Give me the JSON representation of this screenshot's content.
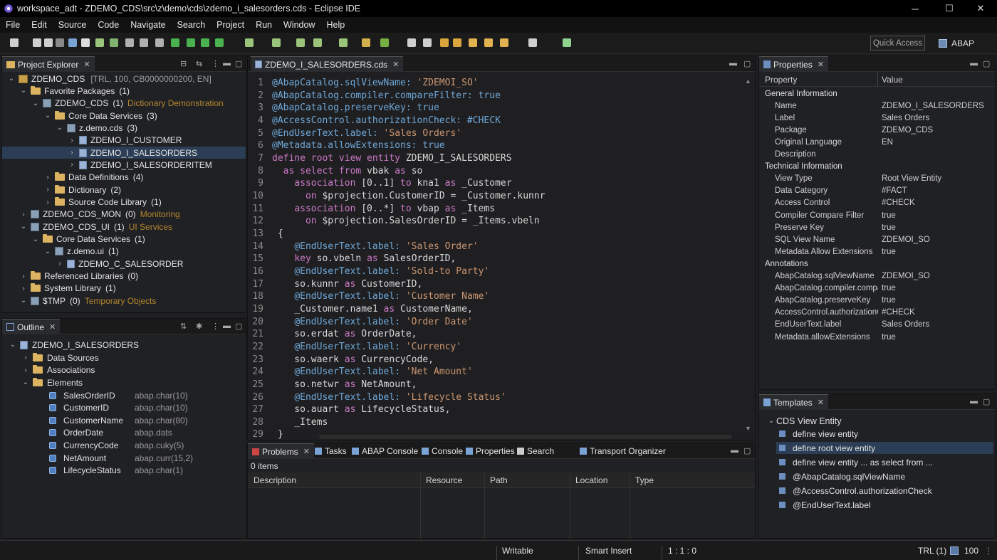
{
  "window": {
    "title": "workspace_adt - ZDEMO_CDS\\src\\z\\demo\\cds\\zdemo_i_salesorders.cds - Eclipse IDE",
    "minimize": "─",
    "maximize": "☐",
    "close": "✕"
  },
  "menu": [
    "File",
    "Edit",
    "Source",
    "Code",
    "Navigate",
    "Search",
    "Project",
    "Run",
    "Window",
    "Help"
  ],
  "toolbar": {
    "quick_access": "Quick Access",
    "perspective": "ABAP"
  },
  "project_explorer": {
    "title": "Project Explorer",
    "items": [
      {
        "label": "ZDEMO_CDS",
        "note": "[TRL, 100, CB0000000200, EN]",
        "note_style": "muted",
        "indent": 0,
        "twisty": "⌄",
        "icon": "project"
      },
      {
        "label": "Favorite Packages",
        "count": "(1)",
        "indent": 1,
        "twisty": "⌄",
        "icon": "folder"
      },
      {
        "label": "ZDEMO_CDS",
        "count": "(1)",
        "note": "Dictionary Demonstration",
        "note_style": "sub",
        "indent": 2,
        "twisty": "⌄",
        "icon": "package"
      },
      {
        "label": "Core Data Services",
        "count": "(3)",
        "indent": 3,
        "twisty": "⌄",
        "icon": "folder"
      },
      {
        "label": "z.demo.cds",
        "count": "(3)",
        "indent": 4,
        "twisty": "⌄",
        "icon": "package"
      },
      {
        "label": "ZDEMO_I_CUSTOMER",
        "indent": 5,
        "twisty": "›",
        "icon": "cds"
      },
      {
        "label": "ZDEMO_I_SALESORDERS",
        "indent": 5,
        "twisty": "›",
        "icon": "cds",
        "selected": true
      },
      {
        "label": "ZDEMO_I_SALESORDERITEM",
        "indent": 5,
        "twisty": "›",
        "icon": "cds"
      },
      {
        "label": "Data Definitions",
        "count": "(4)",
        "indent": 3,
        "twisty": "›",
        "icon": "folder"
      },
      {
        "label": "Dictionary",
        "count": "(2)",
        "indent": 3,
        "twisty": "›",
        "icon": "folder"
      },
      {
        "label": "Source Code Library",
        "count": "(1)",
        "indent": 3,
        "twisty": "›",
        "icon": "folder"
      },
      {
        "label": "ZDEMO_CDS_MON",
        "count": "(0)",
        "note": "Monitoring",
        "note_style": "sub",
        "indent": 1,
        "twisty": "›",
        "icon": "package"
      },
      {
        "label": "ZDEMO_CDS_UI",
        "count": "(1)",
        "note": "UI Services",
        "note_style": "sub",
        "indent": 1,
        "twisty": "⌄",
        "icon": "package"
      },
      {
        "label": "Core Data Services",
        "count": "(1)",
        "indent": 2,
        "twisty": "⌄",
        "icon": "folder"
      },
      {
        "label": "z.demo.ui",
        "count": "(1)",
        "indent": 3,
        "twisty": "⌄",
        "icon": "package"
      },
      {
        "label": "ZDEMO_C_SALESORDER",
        "indent": 4,
        "twisty": "›",
        "icon": "cds"
      },
      {
        "label": "Referenced Libraries",
        "count": "(0)",
        "indent": 1,
        "twisty": "›",
        "icon": "folder"
      },
      {
        "label": "System Library",
        "count": "(1)",
        "indent": 1,
        "twisty": "›",
        "icon": "folder"
      },
      {
        "label": "$TMP",
        "count": "(0)",
        "note": "Temporary Objects",
        "note_style": "sub",
        "indent": 1,
        "twisty": "⌄",
        "icon": "package"
      }
    ]
  },
  "outline": {
    "title": "Outline",
    "root": "ZDEMO_I_SALESORDERS",
    "groups": [
      "Data Sources",
      "Associations",
      "Elements"
    ],
    "elements": [
      {
        "name": "SalesOrderID",
        "type": "abap.char(10)"
      },
      {
        "name": "CustomerID",
        "type": "abap.char(10)"
      },
      {
        "name": "CustomerName",
        "type": "abap.char(80)"
      },
      {
        "name": "OrderDate",
        "type": "abap.dats"
      },
      {
        "name": "CurrencyCode",
        "type": "abap.cuky(5)"
      },
      {
        "name": "NetAmount",
        "type": "abap.curr(15,2)"
      },
      {
        "name": "LifecycleStatus",
        "type": "abap.char(1)"
      }
    ]
  },
  "editor": {
    "tab": "ZDEMO_I_SALESORDERS.cds",
    "lines": [
      [
        [
          "a",
          "@AbapCatalog.sqlViewName: "
        ],
        [
          "s",
          "'ZDEMOI_SO'"
        ]
      ],
      [
        [
          "a",
          "@AbapCatalog.compiler.compareFilter: true"
        ]
      ],
      [
        [
          "a",
          "@AbapCatalog.preserveKey: true"
        ]
      ],
      [
        [
          "a",
          "@AccessControl.authorizationCheck: #CHECK"
        ]
      ],
      [
        [
          "a",
          "@EndUserText.label: "
        ],
        [
          "s",
          "'Sales Orders'"
        ]
      ],
      [
        [
          "a",
          "@Metadata.allowExtensions: true"
        ]
      ],
      [
        [
          "k",
          "define root view entity "
        ],
        [
          "p",
          "ZDEMO_I_SALESORDERS"
        ]
      ],
      [
        [
          "p",
          "  "
        ],
        [
          "k",
          "as select from "
        ],
        [
          "p",
          "vbak "
        ],
        [
          "k",
          "as "
        ],
        [
          "p",
          "so"
        ]
      ],
      [
        [
          "p",
          "    "
        ],
        [
          "k",
          "association "
        ],
        [
          "p",
          "[0..1] "
        ],
        [
          "k",
          "to "
        ],
        [
          "p",
          "kna1 "
        ],
        [
          "k",
          "as "
        ],
        [
          "p",
          "_Customer"
        ]
      ],
      [
        [
          "p",
          "      "
        ],
        [
          "k",
          "on "
        ],
        [
          "p",
          "$projection.CustomerID = _Customer.kunnr"
        ]
      ],
      [
        [
          "p",
          "    "
        ],
        [
          "k",
          "association "
        ],
        [
          "p",
          "[0..*] "
        ],
        [
          "k",
          "to "
        ],
        [
          "p",
          "vbap "
        ],
        [
          "k",
          "as "
        ],
        [
          "p",
          "_Items"
        ]
      ],
      [
        [
          "p",
          "      "
        ],
        [
          "k",
          "on "
        ],
        [
          "p",
          "$projection.SalesOrderID = _Items.vbeln"
        ]
      ],
      [
        [
          "p",
          " {"
        ]
      ],
      [
        [
          "p",
          "    "
        ],
        [
          "a",
          "@EndUserText.label: "
        ],
        [
          "s",
          "'Sales Order'"
        ]
      ],
      [
        [
          "p",
          "    "
        ],
        [
          "k",
          "key "
        ],
        [
          "p",
          "so.vbeln "
        ],
        [
          "k",
          "as "
        ],
        [
          "p",
          "SalesOrderID,"
        ]
      ],
      [
        [
          "p",
          "    "
        ],
        [
          "a",
          "@EndUserText.label: "
        ],
        [
          "s",
          "'Sold-to Party'"
        ]
      ],
      [
        [
          "p",
          "    so.kunnr "
        ],
        [
          "k",
          "as "
        ],
        [
          "p",
          "CustomerID,"
        ]
      ],
      [
        [
          "p",
          "    "
        ],
        [
          "a",
          "@EndUserText.label: "
        ],
        [
          "s",
          "'Customer Name'"
        ]
      ],
      [
        [
          "p",
          "    _Customer.name1 "
        ],
        [
          "k",
          "as "
        ],
        [
          "p",
          "CustomerName,"
        ]
      ],
      [
        [
          "p",
          "    "
        ],
        [
          "a",
          "@EndUserText.label: "
        ],
        [
          "s",
          "'Order Date'"
        ]
      ],
      [
        [
          "p",
          "    so.erdat "
        ],
        [
          "k",
          "as "
        ],
        [
          "p",
          "OrderDate,"
        ]
      ],
      [
        [
          "p",
          "    "
        ],
        [
          "a",
          "@EndUserText.label: "
        ],
        [
          "s",
          "'Currency'"
        ]
      ],
      [
        [
          "p",
          "    so.waerk "
        ],
        [
          "k",
          "as "
        ],
        [
          "p",
          "CurrencyCode,"
        ]
      ],
      [
        [
          "p",
          "    "
        ],
        [
          "a",
          "@EndUserText.label: "
        ],
        [
          "s",
          "'Net Amount'"
        ]
      ],
      [
        [
          "p",
          "    so.netwr "
        ],
        [
          "k",
          "as "
        ],
        [
          "p",
          "NetAmount,"
        ]
      ],
      [
        [
          "p",
          "    "
        ],
        [
          "a",
          "@EndUserText.label: "
        ],
        [
          "s",
          "'Lifecycle Status'"
        ]
      ],
      [
        [
          "p",
          "    so.auart "
        ],
        [
          "k",
          "as "
        ],
        [
          "p",
          "LifecycleStatus,"
        ]
      ],
      [
        [
          "p",
          "    _Items"
        ]
      ],
      [
        [
          "p",
          " }"
        ]
      ]
    ]
  },
  "bottom": {
    "tabs": [
      "Problems",
      "Tasks",
      "ABAP Console",
      "Console",
      "Properties",
      "Search",
      "Transport Organizer"
    ],
    "count": "0 items",
    "columns": [
      "Description",
      "Resource",
      "Path",
      "Location",
      "Type"
    ]
  },
  "properties": {
    "title": "Properties",
    "col_property": "Property",
    "col_value": "Value",
    "rows": [
      {
        "k": "General Information",
        "cat": true
      },
      {
        "k": "Name",
        "v": "ZDEMO_I_SALESORDERS"
      },
      {
        "k": "Label",
        "v": "Sales Orders"
      },
      {
        "k": "Package",
        "v": "ZDEMO_CDS"
      },
      {
        "k": "Original Language",
        "v": "EN"
      },
      {
        "k": "Description",
        "v": ""
      },
      {
        "k": "Technical Information",
        "cat": true
      },
      {
        "k": "View Type",
        "v": "Root View Entity"
      },
      {
        "k": "Data Category",
        "v": "#FACT"
      },
      {
        "k": "Access Control",
        "v": "#CHECK"
      },
      {
        "k": "Compiler Compare Filter",
        "v": "true"
      },
      {
        "k": "Preserve Key",
        "v": "true"
      },
      {
        "k": "SQL View Name",
        "v": "ZDEMOI_SO"
      },
      {
        "k": "Metadata Allow Extensions",
        "v": "true"
      },
      {
        "k": "Annotations",
        "cat": true
      },
      {
        "k": "AbapCatalog.sqlViewName",
        "v": "ZDEMOI_SO"
      },
      {
        "k": "AbapCatalog.compiler.compareFilter",
        "v": "true"
      },
      {
        "k": "AbapCatalog.preserveKey",
        "v": "true"
      },
      {
        "k": "AccessControl.authorizationCheck",
        "v": "#CHECK"
      },
      {
        "k": "EndUserText.label",
        "v": "Sales Orders"
      },
      {
        "k": "Metadata.allowExtensions",
        "v": "true"
      }
    ]
  },
  "templates": {
    "title": "Templates",
    "group": "CDS View Entity",
    "items": [
      "define view entity",
      "define root view entity",
      "define view entity ... as select from ...",
      "@AbapCatalog.sqlViewName",
      "@AccessControl.authorizationCheck",
      "@EndUserText.label"
    ],
    "selected": 1
  },
  "statusbar": {
    "writable": "Writable",
    "insert": "Smart Insert",
    "position": "1 : 1 : 0",
    "system": "TRL (1)",
    "client": "100"
  }
}
